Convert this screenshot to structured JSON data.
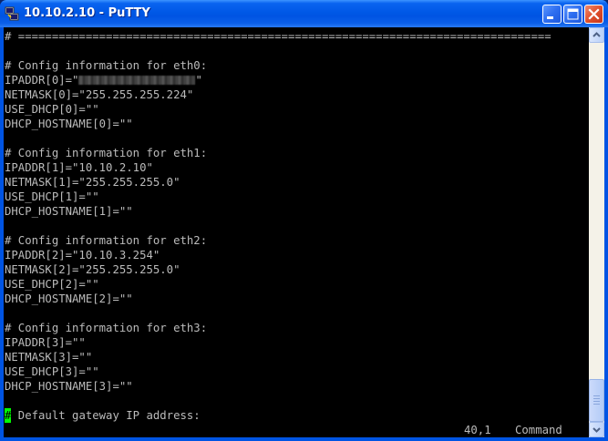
{
  "window": {
    "title": "10.10.2.10 - PuTTY",
    "icon": "putty-icon",
    "controls": {
      "minimize": "minimize-icon",
      "maximize": "maximize-icon",
      "close": "close-icon"
    }
  },
  "terminal": {
    "lines": [
      "# ===============================================================================",
      "",
      "# Config information for eth0:",
      "IPADDR[0]=\"",
      "NETMASK[0]=\"255.255.255.224\"",
      "USE_DHCP[0]=\"\"",
      "DHCP_HOSTNAME[0]=\"\"",
      "",
      "# Config information for eth1:",
      "IPADDR[1]=\"10.10.2.10\"",
      "NETMASK[1]=\"255.255.255.0\"",
      "USE_DHCP[1]=\"\"",
      "DHCP_HOSTNAME[1]=\"\"",
      "",
      "# Config information for eth2:",
      "IPADDR[2]=\"10.10.3.254\"",
      "NETMASK[2]=\"255.255.255.0\"",
      "USE_DHCP[2]=\"\"",
      "DHCP_HOSTNAME[2]=\"\"",
      "",
      "# Config information for eth3:",
      "IPADDR[3]=\"\"",
      "NETMASK[3]=\"\"",
      "USE_DHCP[3]=\"\"",
      "DHCP_HOSTNAME[3]=\"\"",
      "",
      " Default gateway IP address:"
    ],
    "eth0_ip_suffix": "\"",
    "cursor_char": "#",
    "status_position": "40,1",
    "status_mode": "Command",
    "colors": {
      "background": "#000000",
      "foreground": "#bbbbbb",
      "cursor": "#00ff00"
    }
  }
}
